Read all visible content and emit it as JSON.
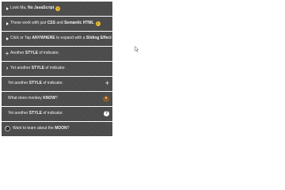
{
  "items": [
    {
      "pre": "Look Ma,",
      "bold": "No JavaScript",
      "suf": "",
      "tail": "",
      "emoji": "⚠"
    },
    {
      "pre": "These work with just",
      "bold": "CSS",
      "mid": "and",
      "bold2": "Semantic HTML",
      "emoji": "⚠"
    },
    {
      "pre": "Click or Tap",
      "bold": "ANYWHERE",
      "mid": "to expand with a",
      "bold2": "Sliding Effect"
    },
    {
      "pre": "Another",
      "bold": "STYLE",
      "suf": "of indicator."
    },
    {
      "pre": "Yet another",
      "bold": "STYLE",
      "suf": "of indicator."
    },
    {
      "pre": "Yet another",
      "bold": "STYLE",
      "suf": "of indicator."
    },
    {
      "pre": "What does monkey",
      "bold": "KNOW",
      "suf": "?"
    },
    {
      "pre": "Yet another",
      "bold": "STYLE",
      "suf": "of indicator."
    },
    {
      "pre": "Want to learn about the",
      "bold": "MOON",
      "suf": "?"
    }
  ],
  "indicators": {
    "triangle": "triangle-right",
    "plus": "+",
    "chevron": "›",
    "question": "?",
    "moon": "moon",
    "monkey": "monkey"
  }
}
